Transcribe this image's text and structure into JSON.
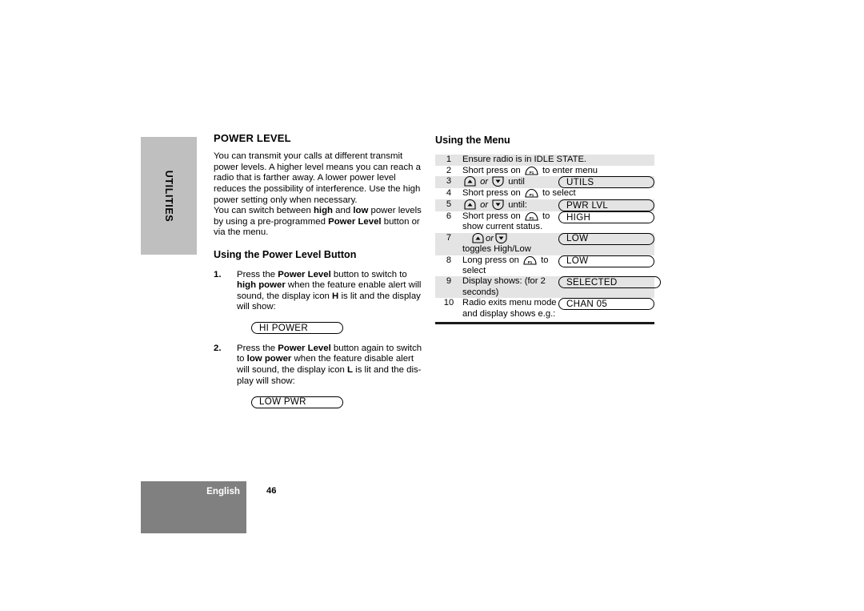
{
  "page": {
    "number": "46",
    "language": "English",
    "side_tab": "UTILITIES"
  },
  "left": {
    "heading": "POWER LEVEL",
    "paragraph1": "You can transmit your calls at different transmit power levels. A higher level means you can reach a radio that is farther away. A lower power level reduces the possibility of interference. Use the high power setting only when necessary.",
    "para2_a": "You can switch between ",
    "para2_b": "high",
    "para2_c": " and ",
    "para2_d": "low",
    "para2_e": " power levels by using a pre-programmed ",
    "para2_f": "Power Level",
    "para2_g": " button or via the menu.",
    "subheading": "Using the Power Level Button",
    "steps": [
      {
        "num": "1.",
        "a": "Press the ",
        "b": "Power Level",
        "c": " button to switch to ",
        "d": "high power",
        "e": " when the feature enable alert  will sound, the display icon ",
        "f": "H",
        "g": " is lit and the display will show:",
        "display": "HI POWER"
      },
      {
        "num": "2.",
        "a": "Press the ",
        "b": "Power Level",
        "c": " button again to switch to ",
        "d": "low power",
        "e": " when the feature disable alert will sound, the display icon ",
        "f": "L",
        "g": " is lit and the dis-play will show:",
        "display": "LOW PWR"
      }
    ]
  },
  "right": {
    "heading": "Using the Menu",
    "icons": {
      "p1": "p1-button-icon",
      "up": "up-arrow-key-icon",
      "down": "down-arrow-key-icon"
    },
    "or_label": "or",
    "rows": [
      {
        "num": "1",
        "text": "Ensure radio is in IDLE STATE.",
        "display": ""
      },
      {
        "num": "2",
        "pre": "Short press on",
        "post": "to enter menu",
        "key": "p1",
        "display": ""
      },
      {
        "num": "3",
        "arrows": true,
        "post": "until",
        "display": "UTILS"
      },
      {
        "num": "4",
        "pre": "Short press on",
        "post": "to select",
        "key": "p1",
        "display": ""
      },
      {
        "num": "5",
        "arrows": true,
        "post": "until:",
        "display": "PWR LVL"
      },
      {
        "num": "6",
        "pre": "Short press on",
        "post": "to show current status.",
        "key": "p1",
        "display": "HIGH"
      },
      {
        "num": "7",
        "arrows": true,
        "post": "toggles High/Low",
        "display": "LOW"
      },
      {
        "num": "8",
        "pre": "Long press on",
        "post": "to select",
        "key": "p1",
        "display": "LOW"
      },
      {
        "num": "9",
        "text": "Display shows: (for 2 seconds)",
        "display": "SELECTED"
      },
      {
        "num": "10",
        "text": "Radio exits menu mode and display shows e.g.:",
        "display": "CHAN  05"
      }
    ]
  },
  "colors": {
    "side_tab_gray": "#bfbfbf",
    "footer_gray": "#808080",
    "row_shade_gray": "#e4e4e4",
    "rule_black": "#1a1a1a"
  }
}
